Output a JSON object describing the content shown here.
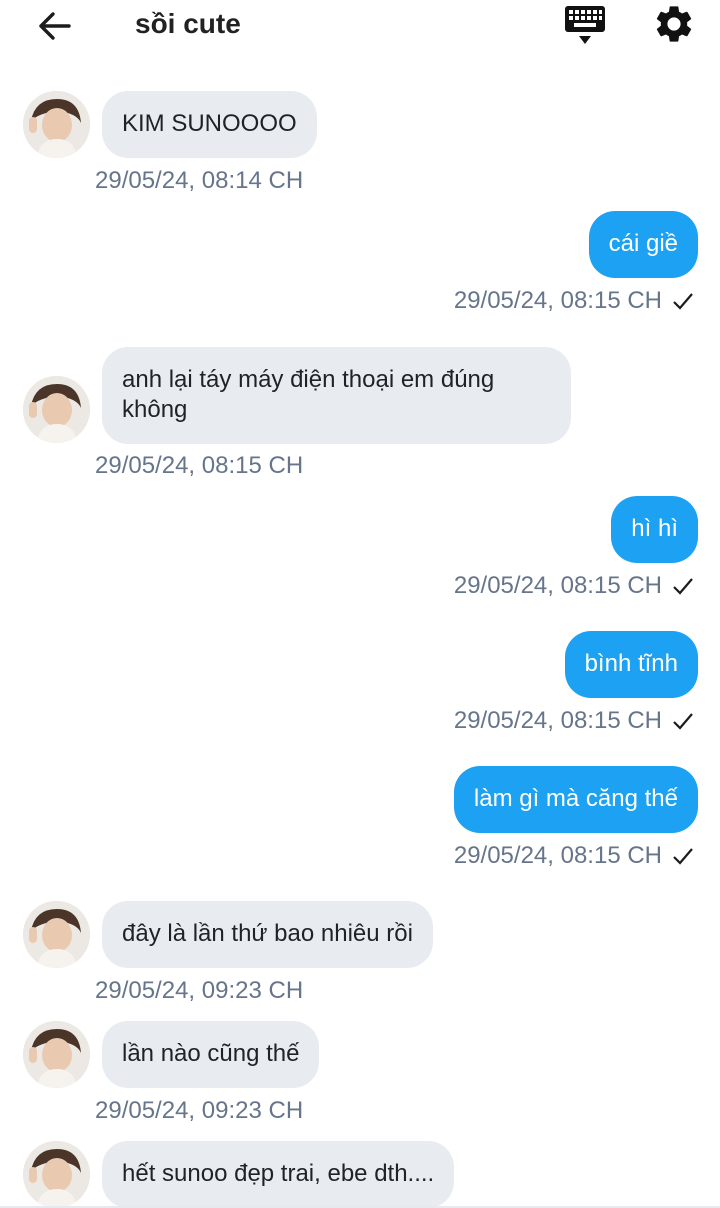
{
  "header": {
    "title": "sồi cute",
    "back_icon": "arrow-left-icon",
    "keyboard_icon": "keyboard-icon",
    "settings_icon": "gear-icon"
  },
  "colors": {
    "incoming_bubble": "#e8ecf1",
    "outgoing_bubble": "#1da1f2",
    "timestamp": "#66758a"
  },
  "messages": [
    {
      "dir": "in",
      "text": "KIM SUNOOOO",
      "time": "29/05/24, 08:14 CH"
    },
    {
      "dir": "out",
      "text": "cái giề",
      "time": "29/05/24, 08:15 CH",
      "status": "sent-check"
    },
    {
      "dir": "in",
      "text": "anh lại táy máy điện thoại em đúng không",
      "time": "29/05/24, 08:15 CH"
    },
    {
      "dir": "out",
      "text": "hì hì",
      "time": "29/05/24, 08:15 CH",
      "status": "sent-check"
    },
    {
      "dir": "out",
      "text": "bình tĩnh",
      "time": "29/05/24, 08:15 CH",
      "status": "sent-check"
    },
    {
      "dir": "out",
      "text": "làm gì mà căng thế",
      "time": "29/05/24, 08:15 CH",
      "status": "sent-check"
    },
    {
      "dir": "in",
      "text": "đây là lần thứ bao nhiêu rồi",
      "time": "29/05/24, 09:23 CH"
    },
    {
      "dir": "in",
      "text": "lần nào cũng thế",
      "time": "29/05/24, 09:23 CH"
    },
    {
      "dir": "in",
      "text": "hết sunoo đẹp trai, ebe dth....",
      "time": ""
    }
  ]
}
